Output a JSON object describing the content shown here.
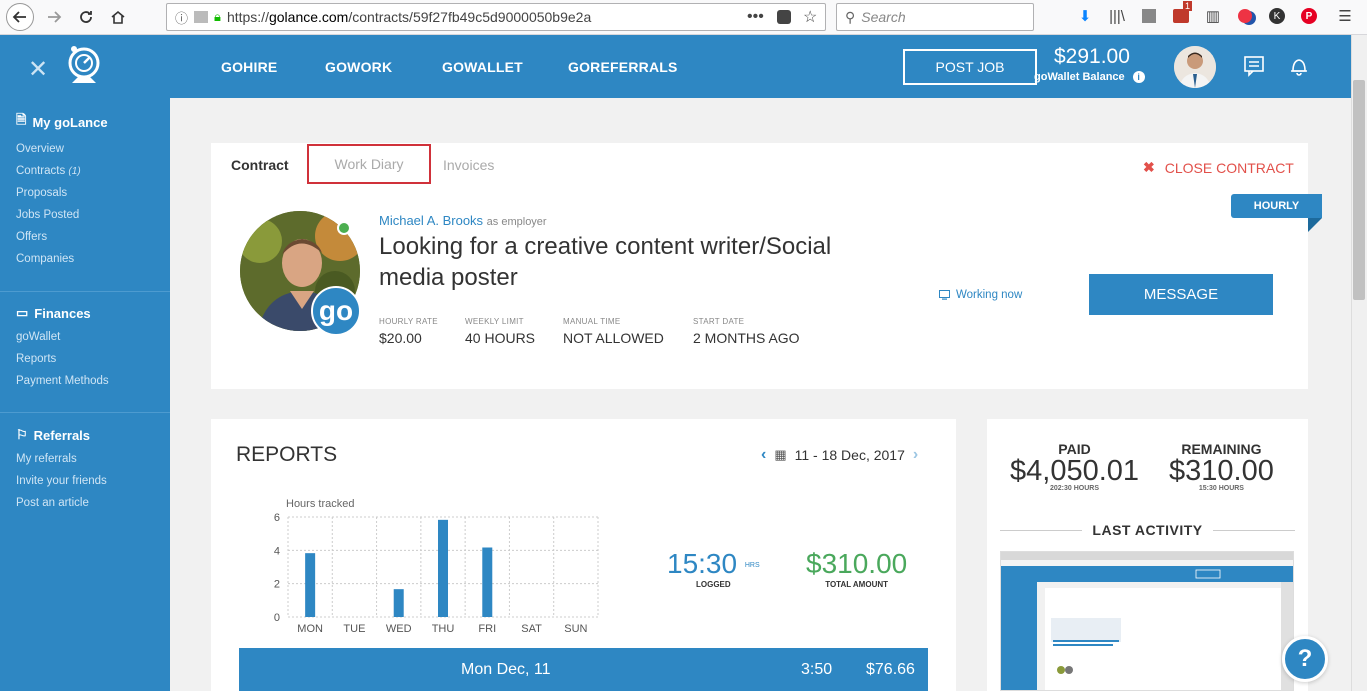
{
  "browser": {
    "url_prefix": "https://",
    "url_host": "golance.com",
    "url_path": "/contracts/59f27fb49c5d9000050b9e2a",
    "search_placeholder": "Search",
    "notification_count": "1"
  },
  "header": {
    "nav": [
      "GOHIRE",
      "GOWORK",
      "GOWALLET",
      "GOREFERRALS"
    ],
    "post_job": "POST JOB",
    "balance_amount": "$291.00",
    "balance_label": "goWallet Balance"
  },
  "sidebar": {
    "my_golance": {
      "title": "My goLance",
      "items": [
        "Overview",
        "Contracts",
        "Proposals",
        "Jobs Posted",
        "Offers",
        "Companies"
      ],
      "contracts_count": "(1)"
    },
    "finances": {
      "title": "Finances",
      "items": [
        "goWallet",
        "Reports",
        "Payment Methods"
      ]
    },
    "referrals": {
      "title": "Referrals",
      "items": [
        "My referrals",
        "Invite your friends",
        "Post an article"
      ]
    }
  },
  "contract": {
    "tabs": [
      "Contract",
      "Work Diary",
      "Invoices"
    ],
    "close_contract": "CLOSE CONTRACT",
    "badge": "HOURLY",
    "employer_name": "Michael A. Brooks",
    "employer_role": "as employer",
    "title": "Looking for a creative content writer/Social media poster",
    "stats": [
      {
        "label": "HOURLY RATE",
        "value": "$20.00"
      },
      {
        "label": "WEEKLY LIMIT",
        "value": "40 HOURS"
      },
      {
        "label": "MANUAL TIME",
        "value": "NOT ALLOWED"
      },
      {
        "label": "START DATE",
        "value": "2 MONTHS AGO"
      }
    ],
    "status": "Working now",
    "message_button": "MESSAGE",
    "badge_text": "go"
  },
  "reports": {
    "title": "REPORTS",
    "date_range": "11 - 18 Dec, 2017",
    "logged_value": "15:30",
    "logged_unit": "HRS",
    "logged_label": "LOGGED",
    "total_value": "$310.00",
    "total_label": "TOTAL AMOUNT",
    "day_row": {
      "date": "Mon Dec, 11",
      "hours": "3:50",
      "amount": "$76.66"
    }
  },
  "chart_data": {
    "type": "bar",
    "title": "Hours tracked",
    "categories": [
      "MON",
      "TUE",
      "WED",
      "THU",
      "FRI",
      "SAT",
      "SUN"
    ],
    "values": [
      3.83,
      0,
      1.67,
      5.83,
      4.17,
      0,
      0
    ],
    "ylim": [
      0,
      6
    ],
    "yticks": [
      "0",
      "2",
      "4",
      "6"
    ],
    "grid": true,
    "bar_color": "#2e87c3"
  },
  "summary": {
    "paid_label": "PAID",
    "paid_amount": "$4,050.01",
    "paid_hours": "202:30 HOURS",
    "remaining_label": "REMAINING",
    "remaining_amount": "$310.00",
    "remaining_hours": "15:30 HOURS",
    "last_activity": "LAST ACTIVITY"
  },
  "help": "?",
  "colors": {
    "primary": "#2e87c3",
    "danger": "#e2504a",
    "success": "#4aa85c"
  }
}
